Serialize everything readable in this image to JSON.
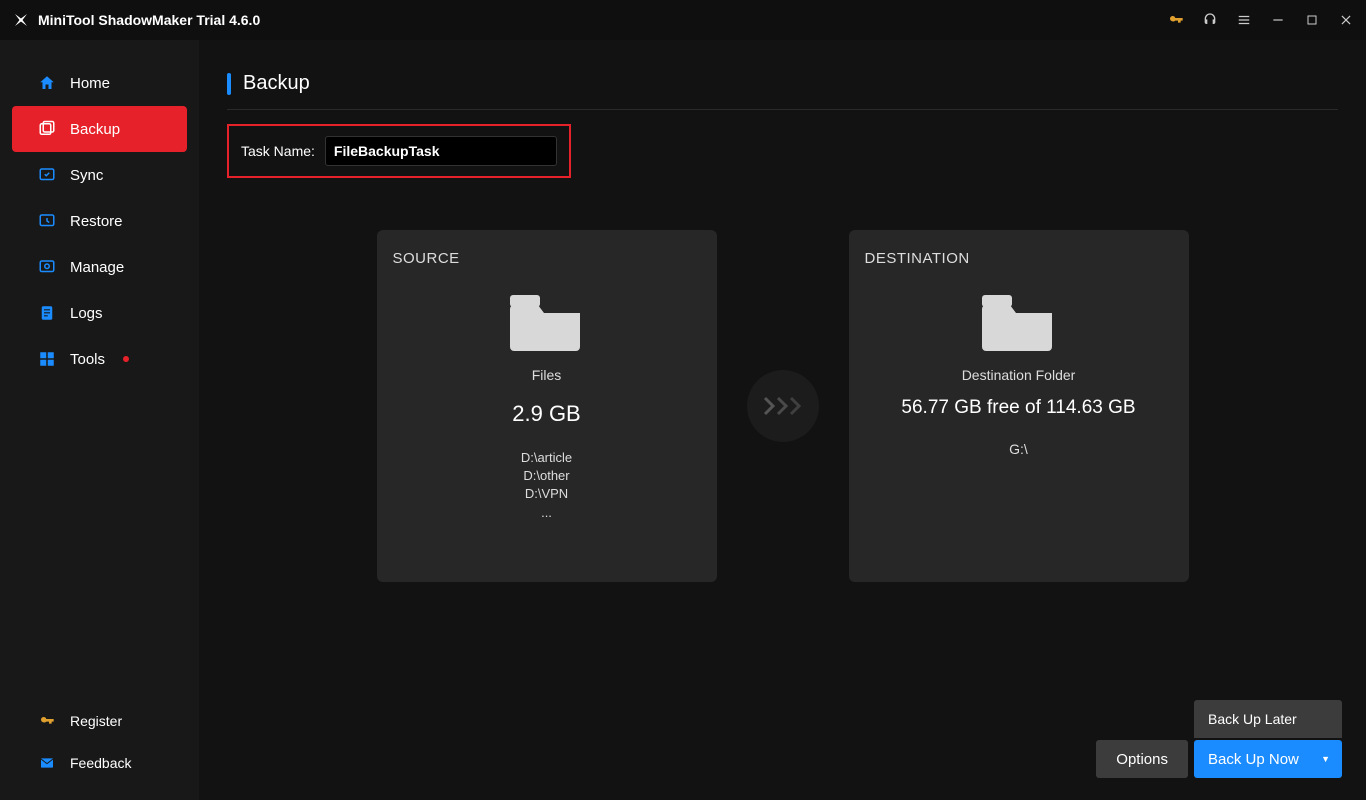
{
  "app": {
    "title": "MiniTool ShadowMaker Trial 4.6.0"
  },
  "sidebar": {
    "items": [
      {
        "label": "Home"
      },
      {
        "label": "Backup"
      },
      {
        "label": "Sync"
      },
      {
        "label": "Restore"
      },
      {
        "label": "Manage"
      },
      {
        "label": "Logs"
      },
      {
        "label": "Tools"
      }
    ],
    "bottom": [
      {
        "label": "Register"
      },
      {
        "label": "Feedback"
      }
    ]
  },
  "page": {
    "title": "Backup",
    "task_label": "Task Name:",
    "task_value": "FileBackupTask"
  },
  "source": {
    "heading": "SOURCE",
    "type_label": "Files",
    "size": "2.9 GB",
    "paths": [
      "D:\\article",
      "D:\\other",
      "D:\\VPN"
    ],
    "more": "..."
  },
  "destination": {
    "heading": "DESTINATION",
    "type_label": "Destination Folder",
    "free_text": "56.77 GB free of 114.63 GB",
    "path": "G:\\"
  },
  "buttons": {
    "options": "Options",
    "later": "Back Up Later",
    "now": "Back Up Now"
  }
}
